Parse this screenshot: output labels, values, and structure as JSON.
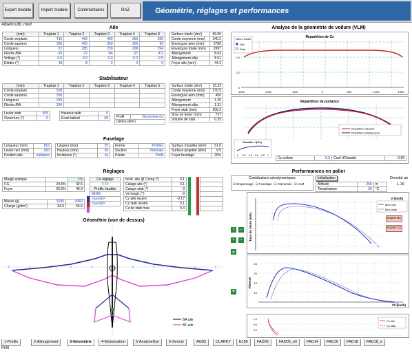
{
  "toolbar": {
    "export_label": "Export modèle",
    "import_label": "Import modèle",
    "comments_label": "Commentaires",
    "raz_label": "RAZ",
    "banner_title": "Géométrie, réglages et performances"
  },
  "file_name": "Albatros3b_mod",
  "sections": {
    "aile": "Aile",
    "stabilisateur": "Stabilisateur",
    "fuselage": "Fuselage",
    "reglages": "Réglages",
    "geometrie": "Géométrie (vue de dessus)",
    "analyse": "Analyse de la géométrie de voilure (VLM)",
    "performances": "Performances en palier"
  },
  "aile": {
    "header": [
      "(mm)",
      "Trapèze 1",
      "Trapèze 2",
      "Trapèze 3",
      "Trapèze 4",
      "Trapèze 5"
    ],
    "rows": [
      [
        "Corde emplant.",
        "415",
        "400",
        "400",
        "350",
        "255"
      ],
      [
        "Corde saumon",
        "395",
        "400",
        "350",
        "255",
        "95"
      ],
      [
        "Longueur",
        "21",
        "285",
        "239",
        "209",
        "394"
      ],
      [
        "Flèche /BA",
        "-26",
        "-72",
        "-84",
        "-27",
        "-4.2"
      ],
      [
        "Vrillage (°)",
        "0.0",
        "0.0",
        "0.0",
        "-0.2",
        "-2.5"
      ],
      [
        "Dièdre (°)",
        "18",
        "8",
        "2",
        "0",
        "0"
      ]
    ],
    "summary": [
      [
        "Surface totale (dm²)",
        "89.90"
      ],
      [
        "Corde moyenne (mm)",
        "340.2"
      ],
      [
        "Envergure aéro (mm)",
        "2780"
      ],
      [
        "Envergure totale (mm)",
        "2997"
      ],
      [
        "Allongement",
        "8.63"
      ],
      [
        "Allongement ellip.",
        "8.51"
      ],
      [
        "Foyer aile (mm)",
        "44.3"
      ]
    ]
  },
  "stab": {
    "header": [
      "(mm)",
      "Trapèze 1",
      "Trapèze 2",
      "Trapèze 3",
      "Trapèze 4",
      "Trapèze 5"
    ],
    "rows": [
      [
        "Corde emplant.",
        "500",
        "",
        "",
        "",
        ""
      ],
      [
        "Corde saumon",
        "300",
        "",
        "",
        "",
        ""
      ],
      [
        "Longueur",
        "225",
        "",
        "",
        "",
        ""
      ],
      [
        "Flèche /BA",
        "394",
        "",
        "",
        "",
        ""
      ]
    ],
    "levier_label": "Levier stab",
    "levier_value": "505",
    "ouverture_label": "Ouverture (°)",
    "ouverture_value": "0",
    "hauteur_label": "Hauteur stab",
    "hauteur_value": "0",
    "ecart_label": "Ecart latéral",
    "ecart_value": "50",
    "profil_label": "Profil",
    "profil_value": "Biconvexe-rts",
    "derive_label": "Dérive (dm²)",
    "summary": [
      [
        "Surface totale (dm²)",
        "15.22"
      ],
      [
        "Corde moyenne (mm)",
        "270.5"
      ],
      [
        "Envergure aéro (mm)",
        "450"
      ],
      [
        "Allongement",
        "1.25"
      ],
      [
        "Allongement ellip.",
        "1.31"
      ],
      [
        "Foyer stab (mm)",
        "206.2"
      ],
      [
        "Bras de levier (mm)",
        "727"
      ],
      [
        "Volume de stab",
        "0.25"
      ]
    ]
  },
  "fuselage": {
    "longueur_label": "Longueur (mm)",
    "longueur_value": "815",
    "levier_label": "Levier nez (mm)",
    "levier_value": "260",
    "position_label": "Position aile",
    "position_value": "médiane",
    "largeur_label": "Largeur (mm)",
    "largeur_value": "25",
    "hauteur_label": "Hauteur (mm)",
    "hauteur_value": "20",
    "incidence_label": "Incidence (°)",
    "incidence_value": "sk",
    "forme_label": "Forme",
    "forme_value": "Profilés",
    "section_label": "Section",
    "section_value": "Normale",
    "pointe_label": "Pointe",
    "pointe_value": "Profil",
    "summary": [
      [
        "Surface mouillée (dm²)",
        "51.6"
      ],
      [
        "Surface projetée (dm²)",
        "9.5"
      ],
      [
        "Foyer fuselage",
        "20%"
      ]
    ]
  },
  "reglages": {
    "marge_label": "Marge statique",
    "marge_value": "1%",
    "cg_label": "CG",
    "cg_pct": "24.5%",
    "cg_mm": "42.5",
    "foyer_label": "Foyer",
    "foyer_pct": "25.5%",
    "foyer_mm": "45.9",
    "masse_label": "Masse (g)",
    "masse_a": "3180",
    "masse_b": "4360",
    "charge_label": "Charge (g/dm²)",
    "charge_a": "34.5",
    "charge_b": "56.5",
    "ceiling_label": "Ce réglage",
    "ceiling_value": "0.30",
    "profils_label": "Profils étudiés",
    "profils": [
      "MH60",
      "<au-fait>",
      "<au-fait>"
    ],
    "incid_rows": [
      [
        "Incid. aile @ Czreg (°)",
        "3.1"
      ],
      [
        "Calage aile (°)",
        "3.1"
      ],
      [
        "Calage stab (°)",
        "-3"
      ],
      [
        "Vé longit. (°)",
        "-3"
      ],
      [
        "Cz aile neutre",
        "-0.17"
      ],
      [
        "Cz stab neutre",
        "3.1"
      ],
      [
        "Cz de stab max.",
        "0.3"
      ]
    ]
  },
  "vlm": {
    "chart1_title": "Répartition de Cz",
    "chart1_legend_title": "Valeur étudié",
    "chart1_legend": [
      "Aile",
      "Stab"
    ],
    "chart1_xticks": [
      "-1500",
      "-1000",
      "-500",
      "0",
      "500",
      "1000",
      "1500"
    ],
    "chart1_yticks": [
      "0.6",
      "0.4",
      "0.2",
      "0"
    ],
    "chart2_title": "Répartition de portance",
    "chart2_legend": [
      "Répartition calculée",
      "Répartition elliptique(de)"
    ],
    "cz_label": "Cz voilure",
    "cz_value": "0.5",
    "coef_label": "Coef d'Oswald",
    "coef_value": "0.96",
    "oswald_label": "Oswald = f(Cz)",
    "oswald_xticks": [
      "0",
      "0.2",
      "0.4",
      "0.6",
      "0.8",
      "1"
    ]
  },
  "perf": {
    "contrib_label": "Contributions aérodynamiques",
    "checks": [
      "Empennage",
      "Fuselage",
      "Intéraction",
      "VLM"
    ],
    "init_label": "Initialisation",
    "altitude_label": "Altitude",
    "altitude_value": "250",
    "altitude_unit": "m",
    "temp_label": "Température",
    "temp_value": "20",
    "temp_unit": "°C",
    "densite_label": "Densité air",
    "densite_value": "1.19",
    "chart1_xlabel": "V (km/h)",
    "chart1_ylabel": "Taux de chute (m/s)",
    "chart1_legend": [
      "Mini-mini",
      "Mini-maxi"
    ],
    "chart1_xticks": [
      "0",
      "20",
      "40",
      "60",
      "80",
      "100",
      "120",
      "140"
    ],
    "chart2_xlabel": "V2 (km/h)",
    "chart2_ylabel": "Finesse",
    "chart2_yticks": [
      "25",
      "20",
      "15",
      "10",
      "5"
    ],
    "chart3_legend": [
      "Cz aile",
      "Cz stab"
    ],
    "chart3_yticks": [
      "1.0",
      "0.8",
      "0.6",
      "0.4",
      "0.2",
      "0.0",
      "-0.2",
      "-0.4"
    ],
    "side_buttons": [
      "Export Bx",
      "Export Cx"
    ]
  },
  "geometry": {
    "legend": [
      "BA aile",
      "BF aile"
    ]
  },
  "tabs": [
    "1-Profils",
    "2-Allongement",
    "3-Géométrie",
    "4-Motorisation",
    "5-AnalyseDyn",
    "6-Servos",
    "AG03",
    "CLARKY",
    "E195",
    "FAD05",
    "FAD05_e9",
    "FAD14",
    "FAD16",
    "FAD18",
    "FAD18_e"
  ],
  "active_tab": "3-Géométrie",
  "status": "Prêt",
  "colors": {
    "banner": "#2e67a8",
    "red_curve": "#d02020",
    "blue_curve": "#2030c0",
    "magenta": "#e040e0",
    "green": "#1fa34a"
  }
}
